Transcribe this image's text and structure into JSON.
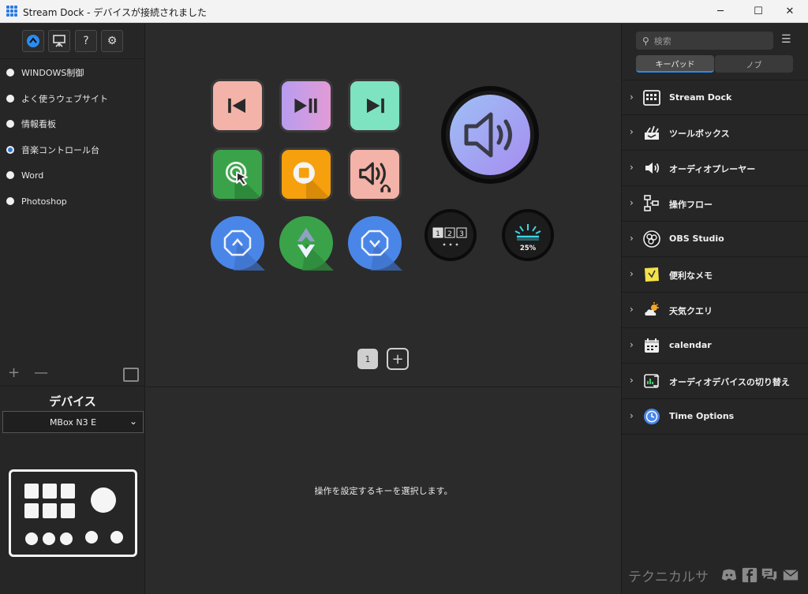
{
  "window": {
    "title": "Stream Dock - デバイスが接続されました",
    "controls": {
      "minimize": "─",
      "maximize": "☐",
      "close": "✕"
    }
  },
  "left_panel": {
    "toolbar": [
      {
        "icon": "stream-dock-logo-icon"
      },
      {
        "icon": "presentation-icon"
      },
      {
        "icon": "help-icon",
        "glyph": "?"
      },
      {
        "icon": "settings-gear-icon",
        "glyph": "⚙"
      }
    ],
    "profiles": [
      {
        "label": "WINDOWS制御",
        "selected": false
      },
      {
        "label": "よく使うウェブサイト",
        "selected": false
      },
      {
        "label": "情報看板",
        "selected": false
      },
      {
        "label": "音楽コントロール台",
        "selected": true
      },
      {
        "label": "Word",
        "selected": false
      },
      {
        "label": "Photoshop",
        "selected": false
      }
    ],
    "add_glyph": "+",
    "remove_glyph": "—",
    "device_heading": "デバイス",
    "device_selected": "MBox N3 E"
  },
  "center": {
    "keys": [
      {
        "name": "previous-track-key",
        "bg": "#f4b3a8"
      },
      {
        "name": "play-pause-key",
        "bg": "#c99be6"
      },
      {
        "name": "next-track-key",
        "bg": "#7de3c1"
      },
      {
        "name": "click-cursor-key",
        "bg": "#3aa34a"
      },
      {
        "name": "stop-key",
        "bg": "#f5a00c"
      },
      {
        "name": "headphone-volume-key",
        "bg": "#f4b3a8"
      }
    ],
    "knob_keys": [
      {
        "name": "up-knob-key",
        "bg": "#4a86e8"
      },
      {
        "name": "shuffle-knob-key",
        "bg": "#3aa34a"
      },
      {
        "name": "down-knob-key",
        "bg": "#4a86e8"
      }
    ],
    "screen_knob_pages": [
      "1",
      "2",
      "3"
    ],
    "brightness_value": "25%",
    "page_number": "1",
    "add_page_glyph": "+",
    "hint": "操作を設定するキーを選択します。"
  },
  "right_panel": {
    "search_placeholder": "検索",
    "tabs": {
      "keypad": "キーパッド",
      "knob": "ノブ"
    },
    "categories": [
      {
        "label": "Stream Dock",
        "icon": "keypad-grid-icon"
      },
      {
        "label": "ツールボックス",
        "icon": "toolbox-icon"
      },
      {
        "label": "オーディオプレーヤー",
        "icon": "speaker-icon"
      },
      {
        "label": "操作フロー",
        "icon": "flow-icon"
      },
      {
        "label": "OBS Studio",
        "icon": "obs-icon"
      },
      {
        "label": "便利なメモ",
        "icon": "sticky-note-icon"
      },
      {
        "label": "天気クエリ",
        "icon": "weather-icon"
      },
      {
        "label": "calendar",
        "icon": "calendar-icon"
      },
      {
        "label": "オーディオデバイスの切り替え",
        "icon": "audio-switch-icon"
      },
      {
        "label": "Time Options",
        "icon": "clock-icon"
      }
    ],
    "footer_brand": "テクニカルサ"
  },
  "colors": {
    "accent_blue": "#2b8cf0",
    "panel_bg": "#262626",
    "center_bg": "#2b2b2b"
  }
}
